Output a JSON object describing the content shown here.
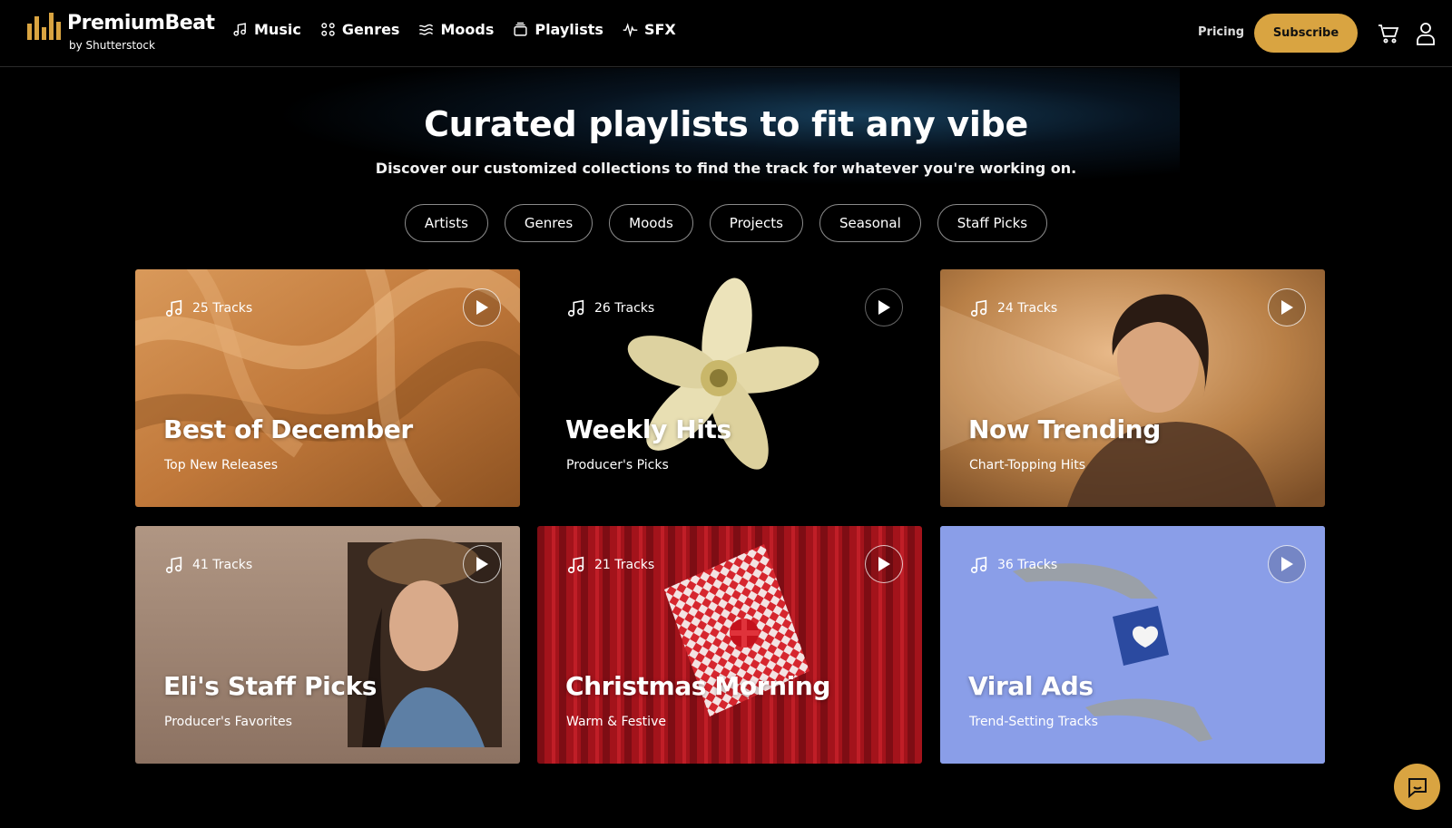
{
  "brand": {
    "name": "PremiumBeat",
    "byline": "by Shutterstock",
    "accent": "#d9a441"
  },
  "nav": [
    {
      "label": "Music",
      "icon": "music-note-icon"
    },
    {
      "label": "Genres",
      "icon": "grid-icon"
    },
    {
      "label": "Moods",
      "icon": "waves-icon"
    },
    {
      "label": "Playlists",
      "icon": "playlist-icon"
    },
    {
      "label": "SFX",
      "icon": "waveform-icon"
    }
  ],
  "header": {
    "pricing_label": "Pricing",
    "subscribe_label": "Subscribe",
    "cart_icon": "cart-icon",
    "account_icon": "account-icon"
  },
  "hero": {
    "title": "Curated playlists to fit any vibe",
    "subtitle": "Discover our customized collections to find the track for whatever you're working on."
  },
  "filters": [
    "Artists",
    "Genres",
    "Moods",
    "Projects",
    "Seasonal",
    "Staff Picks"
  ],
  "playlists": [
    {
      "tracks": "25 Tracks",
      "title": "Best of December",
      "subtitle": "Top New Releases",
      "color": "#c8853f"
    },
    {
      "tracks": "26 Tracks",
      "title": "Weekly Hits",
      "subtitle": "Producer's Picks",
      "color": "#000000"
    },
    {
      "tracks": "24 Tracks",
      "title": "Now Trending",
      "subtitle": "Chart-Topping Hits",
      "color": "#b57f43"
    },
    {
      "tracks": "41 Tracks",
      "title": "Eli's Staff Picks",
      "subtitle": "Producer's Favorites",
      "color": "#a08672"
    },
    {
      "tracks": "21 Tracks",
      "title": "Christmas Morning",
      "subtitle": "Warm & Festive",
      "color": "#a3131b"
    },
    {
      "tracks": "36 Tracks",
      "title": "Viral Ads",
      "subtitle": "Trend-Setting Tracks",
      "color": "#8a9ee8"
    }
  ],
  "chat": {
    "icon": "chat-icon"
  }
}
